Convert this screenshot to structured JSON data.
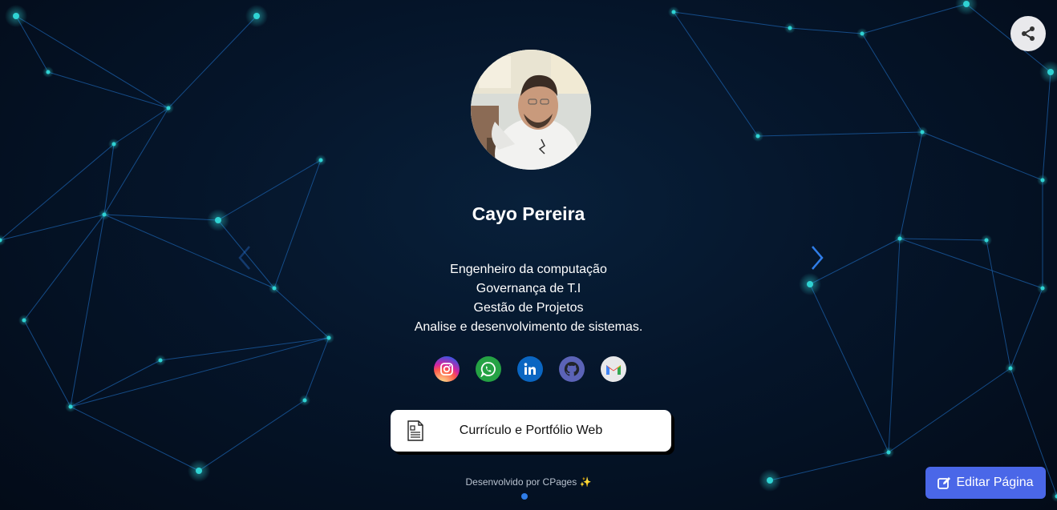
{
  "profile": {
    "name": "Cayo Pereira",
    "bio_lines": [
      "Engenheiro da computação",
      "Governança de T.I",
      "Gestão de Projetos",
      "Analise e desenvolvimento de sistemas."
    ]
  },
  "social_links": [
    {
      "icon": "instagram-icon"
    },
    {
      "icon": "whatsapp-icon"
    },
    {
      "icon": "linkedin-icon"
    },
    {
      "icon": "github-icon"
    },
    {
      "icon": "gmail-icon"
    }
  ],
  "links": [
    {
      "label": "Currículo e Portfólio Web",
      "icon": "document-icon"
    }
  ],
  "footer": {
    "credit": "Desenvolvido por CPages ✨"
  },
  "edit_button": {
    "label": "Editar Página"
  },
  "colors": {
    "background": "#05152a",
    "network_line": "#1b5fa8",
    "network_node": "#2fd3d3",
    "edit_button": "#4a67e8",
    "page_dot": "#2f7de8"
  }
}
